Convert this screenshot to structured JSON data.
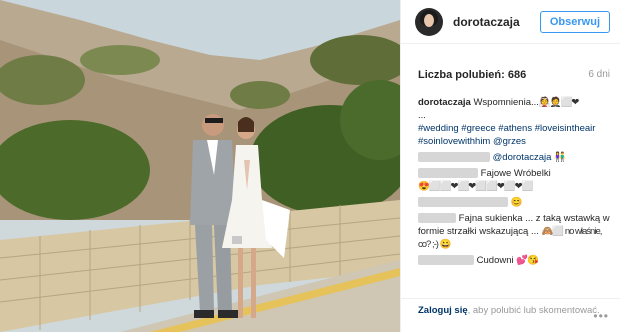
{
  "post": {
    "username": "dorotaczaja",
    "follow_label": "Obserwuj",
    "likes_label": "Liczba polubień: 686",
    "age": "6 dni",
    "caption": {
      "user": "dorotaczaja",
      "text": "Wspomnienia...",
      "emoji": "👰🤵⬜❤",
      "ellipsis": "...",
      "hashtags": "#wedding #greece #athens #loveisintheair #soinlovewithhim @grzes"
    },
    "comments": [
      {
        "mention": "@dorotaczaja",
        "text": "",
        "emoji": "👫"
      },
      {
        "mention": "",
        "text": "Fajowe Wróbelki",
        "emoji": "😍⬜⬜❤⬜❤⬜⬜❤⬜❤⬜"
      },
      {
        "mention": "",
        "text": "",
        "emoji": "😊"
      },
      {
        "mention": "",
        "text": "Fajna sukienka ... z taką wstawką w formie strzałki wskazującą ...",
        "emoji": "🙈⬜ no właśnie, co? ;-) 😀"
      },
      {
        "mention": "",
        "text": "Cudowni",
        "emoji": "💕😘"
      }
    ],
    "footer": {
      "login_label": "Zaloguj się",
      "rest": ", aby polubić lub skomentować.",
      "more_icon": "•••"
    }
  }
}
